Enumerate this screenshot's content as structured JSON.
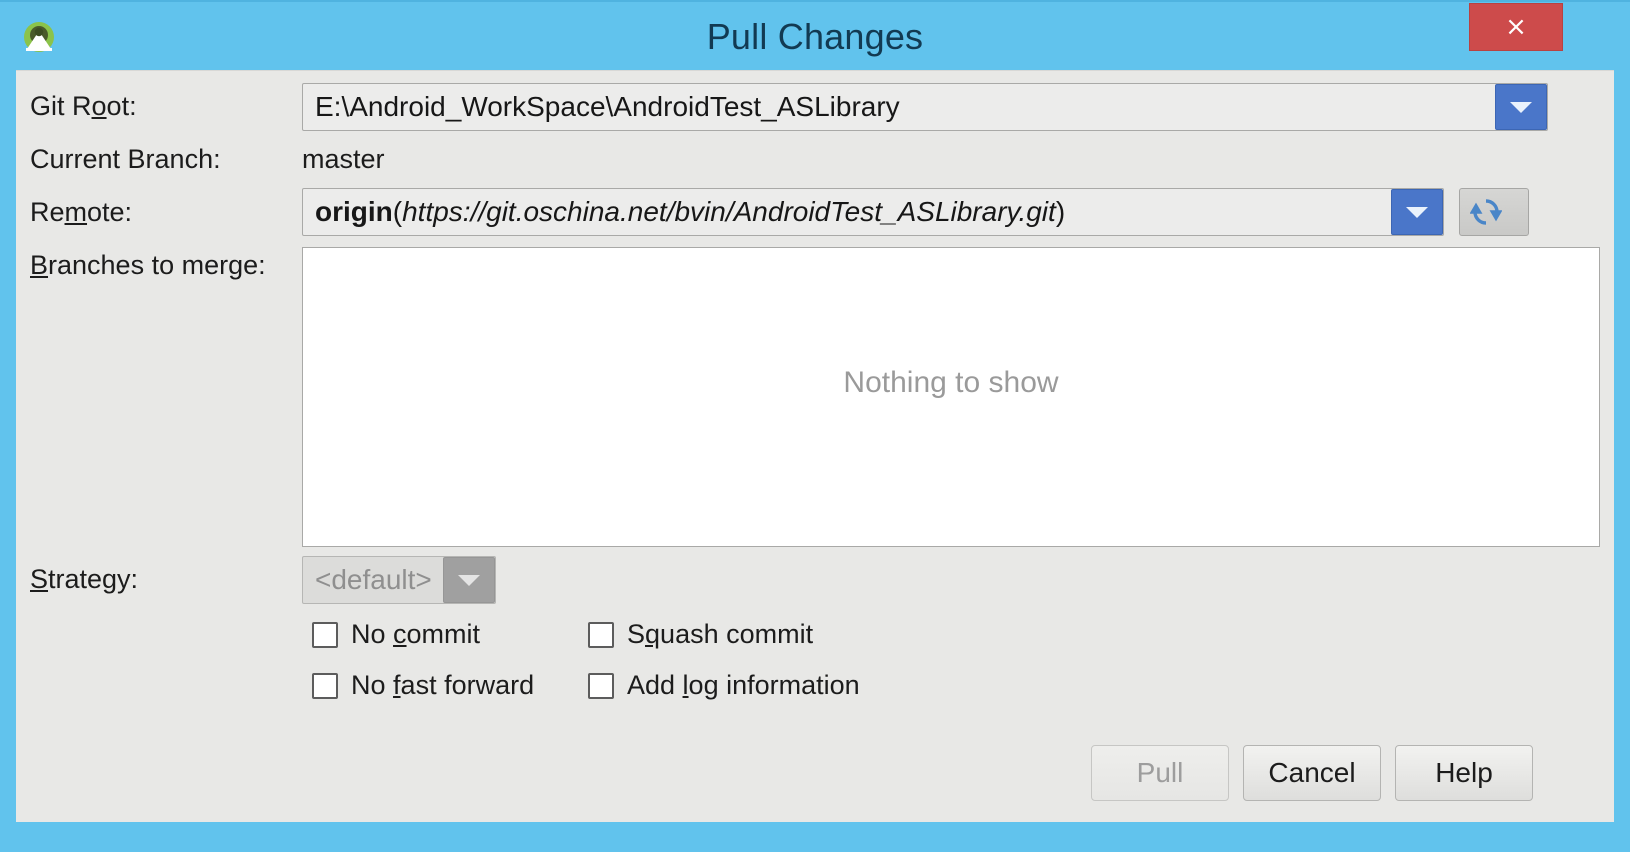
{
  "window": {
    "title": "Pull Changes",
    "app_icon": "android-studio-icon",
    "close_label": "×",
    "accent_color": "#61c3ed",
    "close_color": "#cd4b4b"
  },
  "form": {
    "git_root": {
      "label": "Git Root:",
      "mnemonic": "R",
      "value": "E:\\Android_WorkSpace\\AndroidTest_ASLibrary"
    },
    "current_branch": {
      "label": "Current Branch:",
      "value": "master"
    },
    "remote": {
      "label": "Remote:",
      "mnemonic": "m",
      "value_bold": "origin",
      "value_rest_open": "(",
      "value_italic": "https://git.oschina.net/bvin/AndroidTest_ASLibrary.git",
      "value_rest_close": ")",
      "refresh_icon": "refresh-icon"
    },
    "branches_to_merge": {
      "label": "Branches to merge:",
      "mnemonic": "B",
      "empty_text": "Nothing to show",
      "items": []
    },
    "strategy": {
      "label": "Strategy:",
      "mnemonic": "S",
      "value": "<default>",
      "disabled": true
    },
    "options": [
      {
        "label": "No commit",
        "checked": false
      },
      {
        "label": "Squash commit",
        "checked": false
      },
      {
        "label": "No fast forward",
        "checked": false
      },
      {
        "label": "Add log information",
        "checked": false
      }
    ]
  },
  "buttons": {
    "pull": "Pull",
    "cancel": "Cancel",
    "help": "Help"
  }
}
